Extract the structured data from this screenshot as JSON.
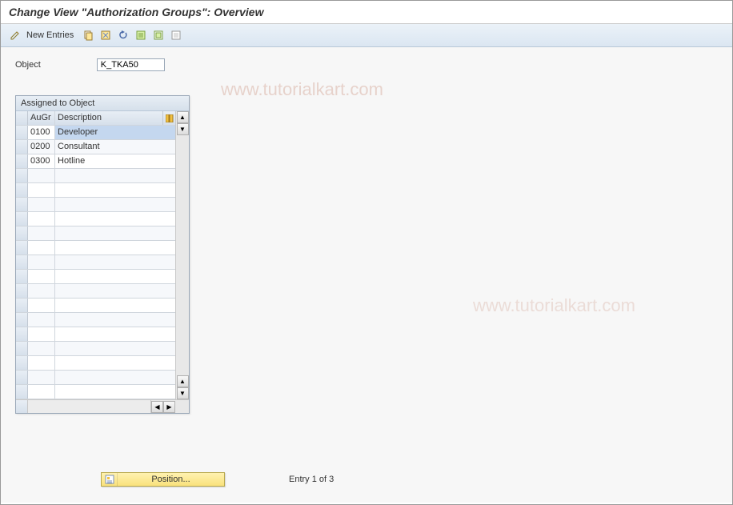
{
  "page_title": "Change View \"Authorization Groups\": Overview",
  "toolbar": {
    "new_entries": "New Entries"
  },
  "object_field": {
    "label": "Object",
    "value": "K_TKA50"
  },
  "grid": {
    "title": "Assigned to Object",
    "columns": {
      "augr": "AuGr",
      "desc": "Description"
    },
    "rows": [
      {
        "augr": "0100",
        "desc": "Developer",
        "selected": true
      },
      {
        "augr": "0200",
        "desc": "Consultant",
        "selected": false
      },
      {
        "augr": "0300",
        "desc": "Hotline",
        "selected": false
      }
    ],
    "empty_rows": 16
  },
  "footer": {
    "position_btn": "Position...",
    "entry_text": "Entry 1 of 3"
  },
  "watermark": "www.tutorialkart.com"
}
